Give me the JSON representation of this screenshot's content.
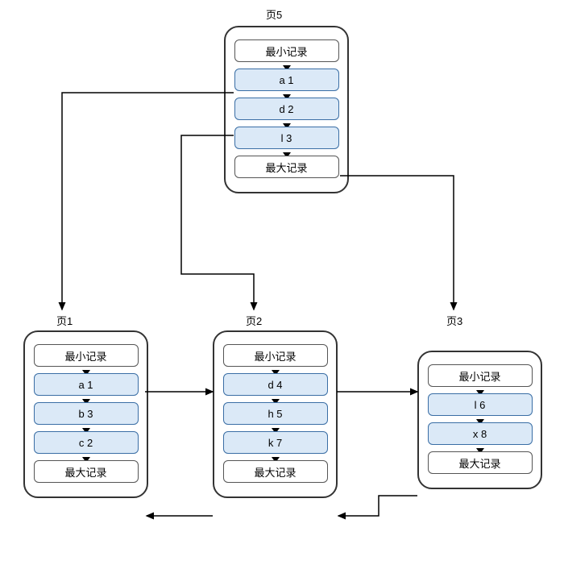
{
  "labels": {
    "page5": "页5",
    "page1": "页1",
    "page2": "页2",
    "page3": "页3"
  },
  "records": {
    "min": "最小记录",
    "max": "最大记录"
  },
  "page5": {
    "r1": "a 1",
    "r2": "d 2",
    "r3": "l 3"
  },
  "page1": {
    "r1": "a 1",
    "r2": "b 3",
    "r3": "c 2"
  },
  "page2": {
    "r1": "d 4",
    "r2": "h 5",
    "r3": "k 7"
  },
  "page3": {
    "r1": "l 6",
    "r2": "x 8"
  }
}
